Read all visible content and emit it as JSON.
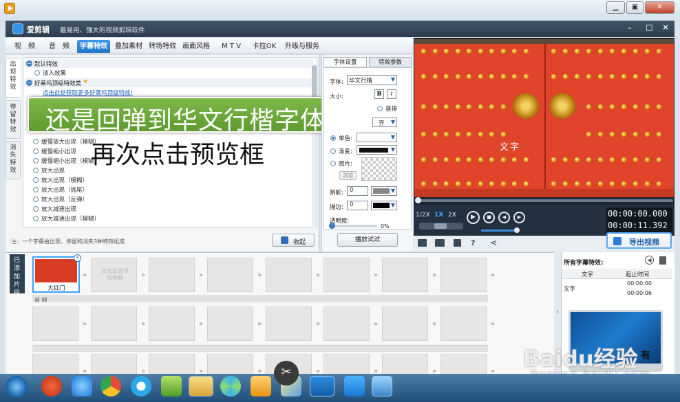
{
  "app": {
    "name": "爱剪辑",
    "tagline": "最易用、强大的视频剪辑软件"
  },
  "window_controls": {
    "minimize": "–",
    "maximize": "□",
    "close": "✕"
  },
  "main_tabs": [
    "视　频",
    "音　频",
    "字幕特效",
    "叠加素材",
    "转场特效",
    "画面风格",
    "M T V",
    "卡拉OK",
    "升级与服务"
  ],
  "side_tabs": [
    "出现特效",
    "停留特效",
    "消失特效"
  ],
  "effects": {
    "groups": [
      {
        "title": "默认特效",
        "items": [
          "淡入效果"
        ]
      },
      {
        "title": "好莱坞顶级特效类"
      }
    ],
    "link": "点击此处获取更多好莱坞顶级特效!",
    "items": [
      "缓慢放大出现（模糊）",
      "缓慢缩小出现",
      "缓慢缩小出现（模糊）",
      "放大出现",
      "放大出现（模糊）",
      "放大出现（抛尾）",
      "放大出现（反弹）",
      "放大减速出现",
      "放大减速出现（模糊）"
    ],
    "note": "注：一个字幕由出现、停留和消失3种特效组成",
    "collapse_btn": "收起"
  },
  "annotations": {
    "banner": "还是回弹到华文行楷字体",
    "instruction": "再次点击预览框"
  },
  "font_panel": {
    "tabs": [
      "字体设置",
      "特效参数"
    ],
    "font_label": "字体:",
    "font_value": "华文行楷",
    "size_label": "大小:",
    "bold": "B",
    "italic": "I",
    "vertical": "竖排",
    "align_value": "齐",
    "single_color": "单色:",
    "gradient": "渐变:",
    "image": "图片:",
    "browse": "浏览",
    "shadow_label": "阴影:",
    "shadow_value": "0",
    "stroke_label": "描边:",
    "stroke_value": "0",
    "opacity_label": "透明度:",
    "opacity_value": "0%",
    "play_test": "播放试试"
  },
  "preview": {
    "caption": "文字",
    "speeds": [
      "1/2X",
      "1X",
      "2X"
    ],
    "time_current": "00:00:00.000",
    "time_total": "00:00:11.392",
    "export": "导出视频"
  },
  "clips": {
    "added_label": "已添加片段",
    "first_clip": "大红门",
    "placeholder": "双击此处添加视频",
    "audio_label": "音 频"
  },
  "subtitle_list": {
    "title": "所有字幕特效:",
    "col_text": "文字",
    "col_time": "起止时间",
    "row_text": "文字",
    "row_start": "00:00:00",
    "row_end": "00:00:06"
  },
  "watermark": {
    "brand": "Baidu经验",
    "url": "jingyan.baidu.com",
    "partial": "有"
  },
  "taskbar": {
    "icons": [
      "start-orb",
      "app-jiang",
      "ie",
      "chrome",
      "qq-browser",
      "folder-app",
      "explorer",
      "pinwheel",
      "media",
      "paint",
      "scissors",
      "aijianji",
      "app-blue",
      "app-grid"
    ]
  }
}
